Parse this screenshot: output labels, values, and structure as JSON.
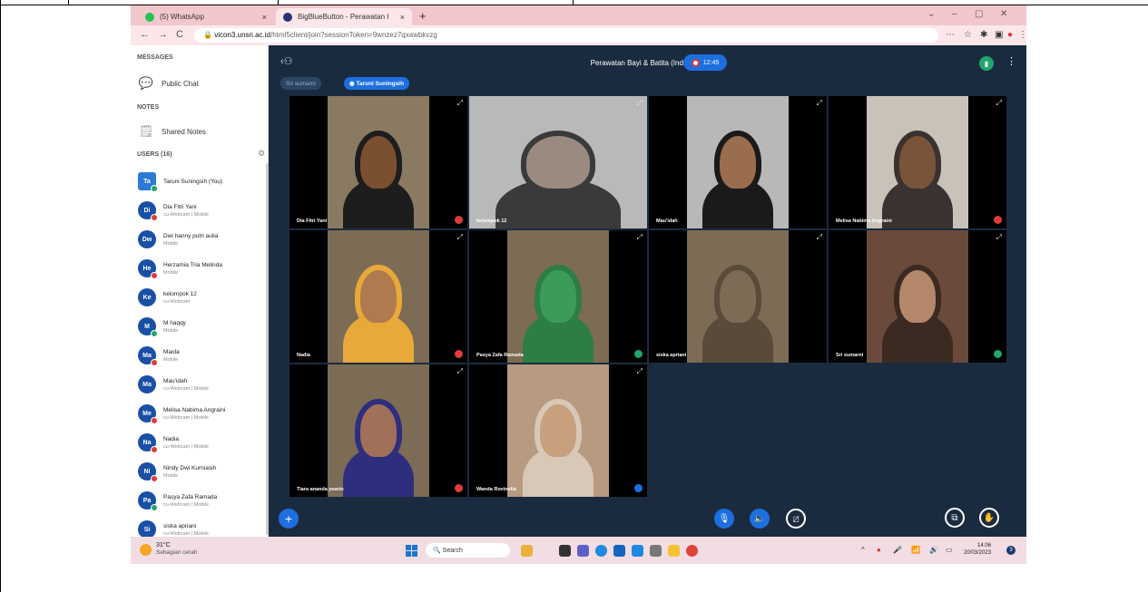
{
  "browser": {
    "tabs": [
      {
        "label": "(5) WhatsApp",
        "close": "×"
      },
      {
        "label": "BigBlueButton - Perawatan I",
        "close": "×"
      }
    ],
    "new_tab": "+",
    "window_controls": [
      "⌄",
      "–",
      "▢",
      "✕"
    ],
    "nav": [
      "←",
      "→",
      "C"
    ],
    "url_host": "vicon3.unsri.ac.id",
    "url_path": "/html5client/join?sessionToken=9wnzez7qxawbkvzg"
  },
  "sidebar": {
    "messages_title": "MESSAGES",
    "public_chat": "Public Chat",
    "notes_title": "NOTES",
    "shared_notes": "Shared Notes",
    "users_title": "USERS (16)",
    "users": [
      {
        "initials": "Ta",
        "name": "Taruni Suningsih (You)",
        "sub": "",
        "me": true,
        "status": "talk"
      },
      {
        "initials": "Di",
        "name": "Dia Fitri Yani",
        "sub": "cu-Webcam | Mobile",
        "status": "muted"
      },
      {
        "initials": "Dw",
        "name": "Dwi hanny putri aulia",
        "sub": "Mobile",
        "status": ""
      },
      {
        "initials": "He",
        "name": "Herzamia Tria Melinda",
        "sub": "Mobile",
        "status": "muted"
      },
      {
        "initials": "Ke",
        "name": "kelompok 12",
        "sub": "cu-Webcam",
        "status": ""
      },
      {
        "initials": "M",
        "name": "M haqqy",
        "sub": "Mobile",
        "status": "talk"
      },
      {
        "initials": "Ma",
        "name": "Maida",
        "sub": "Mobile",
        "status": "muted"
      },
      {
        "initials": "Ma",
        "name": "Mau'idah",
        "sub": "cu-Webcam | Mobile",
        "status": ""
      },
      {
        "initials": "Me",
        "name": "Melisa Nabima Angraini",
        "sub": "cu-Webcam | Mobile",
        "status": "muted"
      },
      {
        "initials": "Na",
        "name": "Nadia",
        "sub": "cu-Webcam | Mobile",
        "status": "muted"
      },
      {
        "initials": "Ni",
        "name": "Nindy Dwi Kurniasih",
        "sub": "Mobile",
        "status": "muted"
      },
      {
        "initials": "Pa",
        "name": "Pasya Zafa Ramada",
        "sub": "cu-Webcam | Mobile",
        "status": "talk"
      },
      {
        "initials": "Si",
        "name": "siska apriani",
        "sub": "cu-Webcam | Mobile",
        "status": ""
      }
    ]
  },
  "meeting": {
    "title": "Perawatan Bayi & Batita (Indralaya)",
    "timer": "12:45",
    "presenters": [
      "Sri sumarni",
      "Taruni Suningsih"
    ],
    "tiles": [
      {
        "name": "Dia Fitri Yani",
        "status": "muted",
        "bg": "#8a7a62",
        "skin": "#7a5030",
        "hijab": "#1d1d1d"
      },
      {
        "name": "kelompok 12",
        "status": "none",
        "bg": "#b9b9b9",
        "skin": "#9a8a80",
        "hijab": "#3a3a3a",
        "wide": true
      },
      {
        "name": "Mau'idah",
        "status": "none",
        "bg": "#b8b9b7",
        "skin": "#9a6d4e",
        "hijab": "#1a1a1a"
      },
      {
        "name": "Melisa Nabima Angraini",
        "status": "muted",
        "bg": "#c8c2b8",
        "skin": "#7a5438",
        "hijab": "#3a3230"
      },
      {
        "name": "Nadia",
        "status": "muted",
        "bg": "#7c6b55",
        "skin": "#b07a50",
        "hijab": "#e8a93a"
      },
      {
        "name": "Pasya Zafa Ramada",
        "status": "talk",
        "bg": "#7c6b55",
        "skin": "#3b9c5a",
        "hijab": "#2d7d46"
      },
      {
        "name": "siska apriani",
        "status": "none",
        "bg": "#7c6b55",
        "skin": "#7c6b55",
        "hijab": "#5a4a3a"
      },
      {
        "name": "Sri sumarni",
        "status": "talk",
        "bg": "#6a4a3a",
        "skin": "#b5876a",
        "hijab": "#3a2a22"
      },
      {
        "name": "Tiara ananda yearin",
        "status": "muted",
        "bg": "#7c6b55",
        "skin": "#a0705a",
        "hijab": "#2e2e7e"
      },
      {
        "name": "Wanda Rovinelia",
        "status": "listen",
        "bg": "#b89a80",
        "skin": "#c8a07e",
        "hijab": "#d8c8b8"
      }
    ]
  },
  "taskbar": {
    "temp": "31°C",
    "weather": "Sebagian cerah",
    "search": "Search",
    "time": "14:06",
    "date": "20/03/2023",
    "notif_count": "3"
  },
  "colors": {
    "accent": "#1d6fe0",
    "meeting_bg": "#1b2b3f",
    "muted": "#e03b3b",
    "talking": "#21a66b"
  }
}
